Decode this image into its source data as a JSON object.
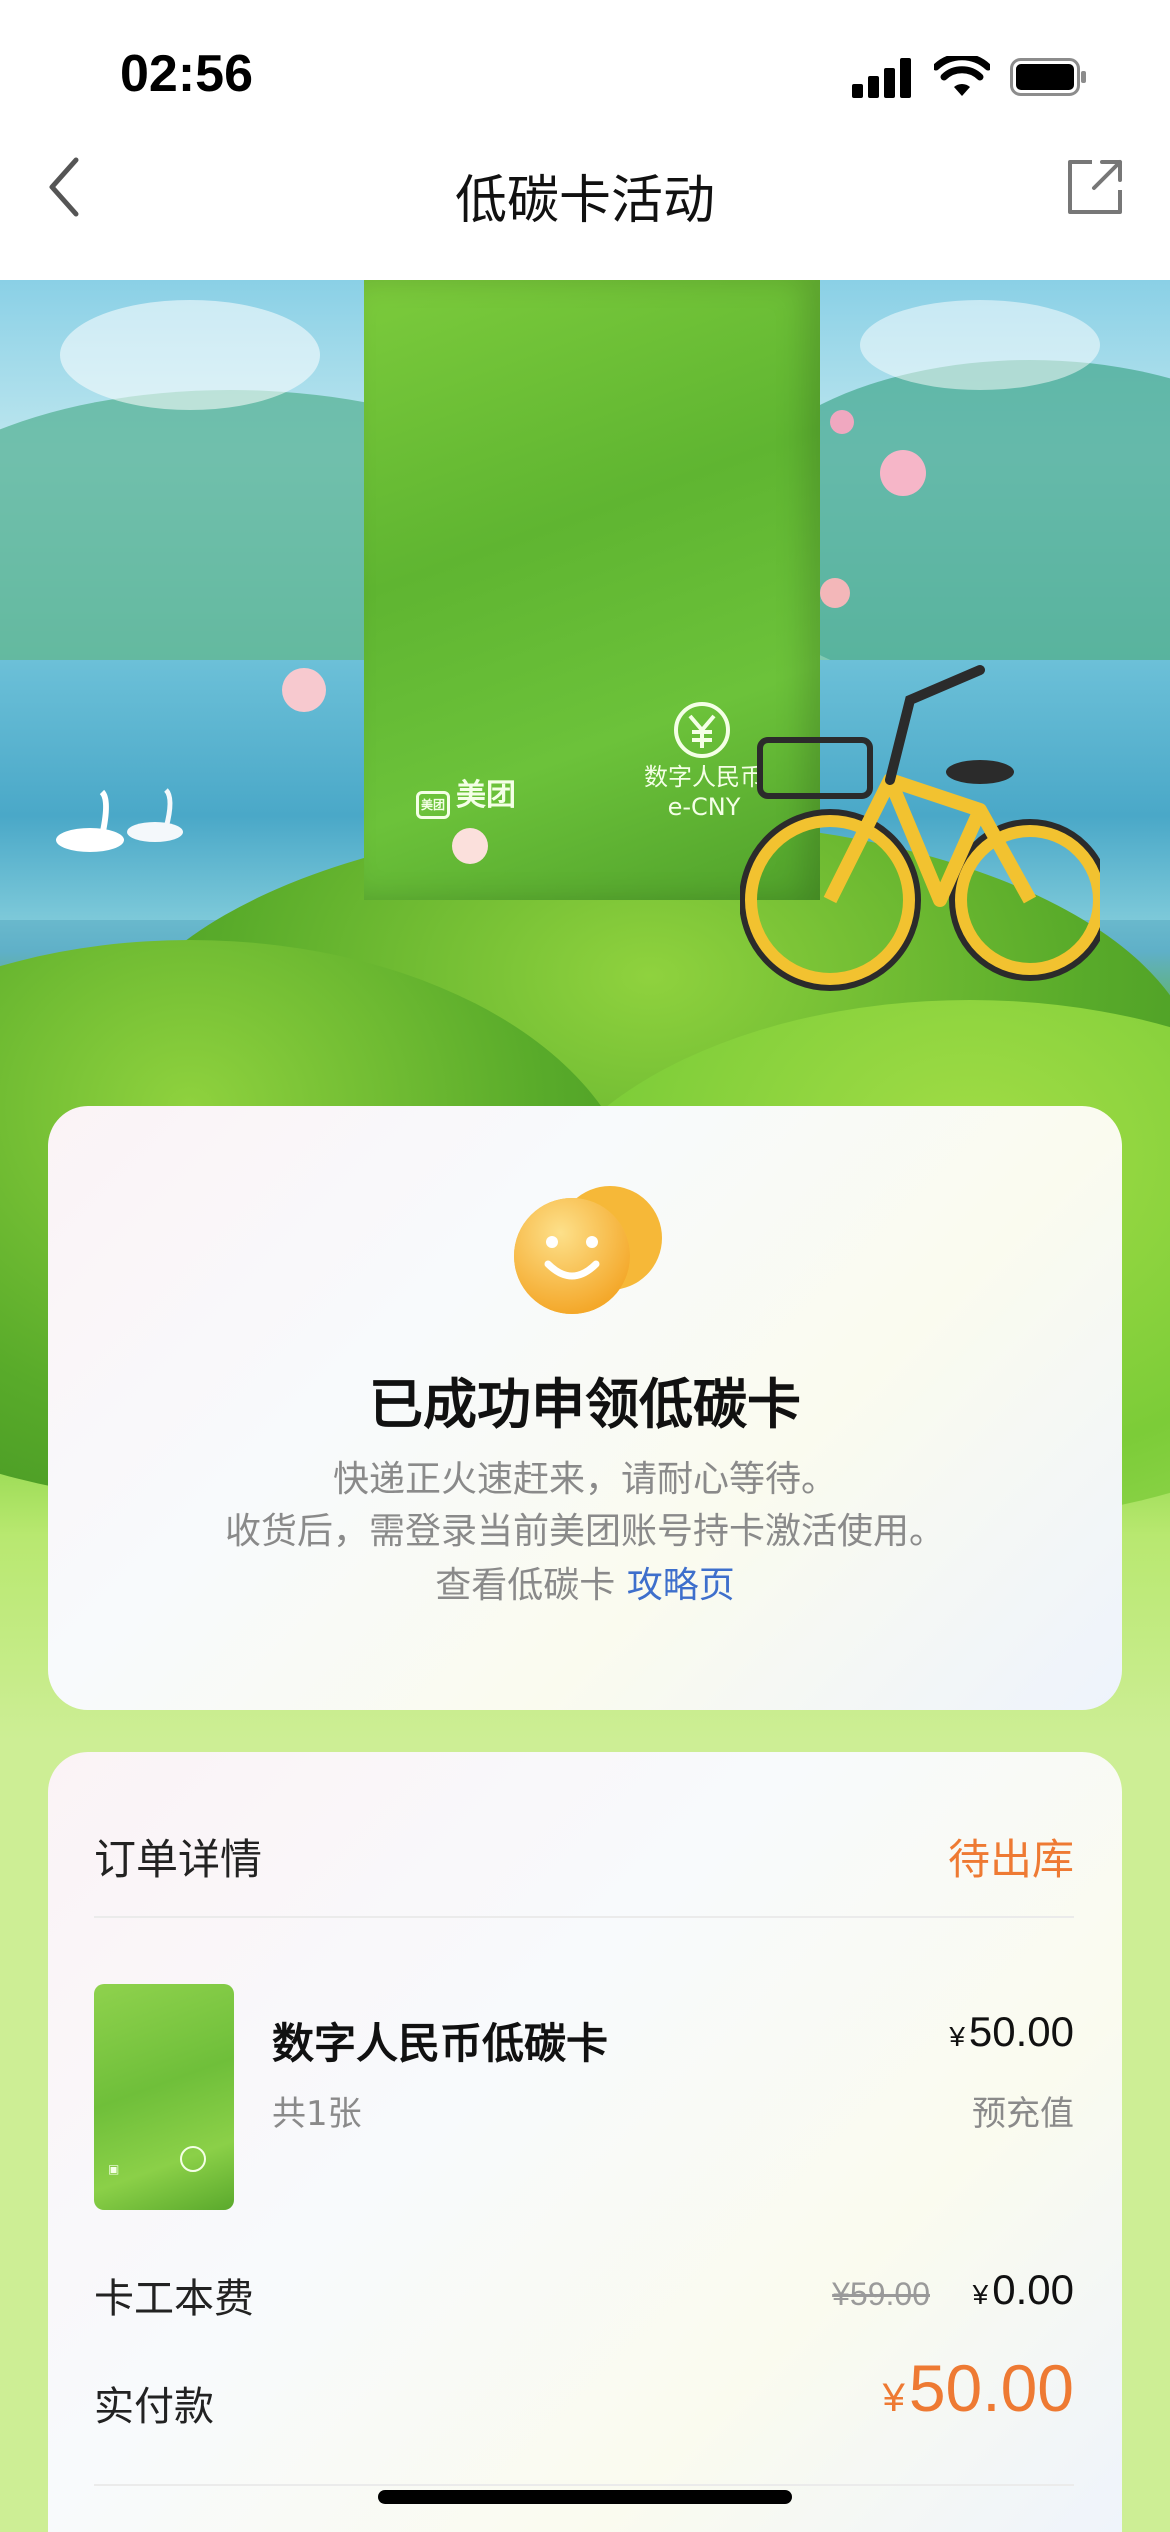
{
  "status_bar": {
    "time": "02:56"
  },
  "nav": {
    "title": "低碳卡活动"
  },
  "hero": {
    "brand_meituan": "美团",
    "brand_ecny_cn": "数字人民币",
    "brand_ecny_en": "e-CNY"
  },
  "result": {
    "title": "已成功申领低碳卡",
    "line1": "快递正火速赶来，请耐心等待。",
    "line2": "收货后，需登录当前美团账号持卡激活使用。",
    "line3_prefix": "查看低碳卡",
    "line3_link": "攻略页"
  },
  "order": {
    "title": "订单详情",
    "status": "待出库",
    "product_name": "数字人民币低碳卡",
    "quantity": "共1张",
    "price_symbol": "¥",
    "price": "50.00",
    "price_tag": "预充值",
    "fee_label": "卡工本费",
    "fee_original": "¥59.00",
    "fee_symbol": "¥",
    "fee_now": "0.00",
    "paid_label": "实付款",
    "paid_symbol": "¥",
    "paid_amount": "50.00"
  },
  "colors": {
    "accent_orange": "#ee7a33",
    "link_blue": "#3e6fcc"
  },
  "icons": [
    "back-icon",
    "share-icon",
    "signal-icon",
    "wifi-icon",
    "battery-icon",
    "smile-icon"
  ]
}
